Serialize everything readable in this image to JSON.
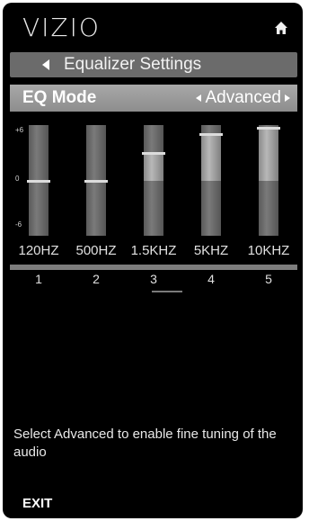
{
  "brand": {
    "logo_text": "VIZIO"
  },
  "icons": {
    "home": "home-icon",
    "back": "left-arrow-icon"
  },
  "header": {
    "title": "Equalizer Settings"
  },
  "eq_mode": {
    "label": "EQ Mode",
    "value": "Advanced"
  },
  "scale": {
    "top": "+6",
    "mid": "0",
    "bottom": "-6"
  },
  "bands": [
    {
      "freq": "120HZ",
      "num": "1",
      "level": 0.0
    },
    {
      "freq": "500HZ",
      "num": "2",
      "level": 0.0
    },
    {
      "freq": "1.5KHZ",
      "num": "3",
      "level": 3.0
    },
    {
      "freq": "5KHZ",
      "num": "4",
      "level": 5.0
    },
    {
      "freq": "10KHZ",
      "num": "5",
      "level": 5.7
    }
  ],
  "help": {
    "text": "Select Advanced to enable fine tuning of the audio"
  },
  "footer": {
    "exit_label": "EXIT"
  },
  "colors": {
    "bar_bg": "#6b6b6b",
    "mode_bar": "#9a9a9a",
    "panel": "#000000"
  }
}
